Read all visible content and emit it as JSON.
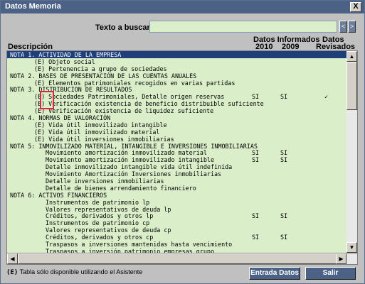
{
  "window": {
    "title": "Datos Memoria",
    "close_label": "X"
  },
  "search": {
    "label": "Texto a buscar",
    "value": "",
    "prev_label": "<",
    "next_label": ">"
  },
  "headers": {
    "description": "Descripción",
    "datos_informados": "Datos Informados",
    "year_2010": "2010",
    "year_2009": "2009",
    "datos": "Datos",
    "revisados": "Revisados"
  },
  "rows": [
    {
      "text": "NOTA 1. ACTIVIDAD DE LA EMPRESA",
      "indent": 0,
      "selected": true
    },
    {
      "text": "(E) Objeto social",
      "indent": 1
    },
    {
      "text": "(E) Pertenencia a grupo de sociedades",
      "indent": 1
    },
    {
      "text": "NOTA 2. BASES DE PRESENTACIÓN DE LAS CUENTAS ANUALES",
      "indent": 0
    },
    {
      "text": "(E) Elementos patrimoniales recogidos en varias partidas",
      "indent": 1
    },
    {
      "text": "NOTA 3. DISTRIBUCION DE RESULTADOS",
      "indent": 0
    },
    {
      "text": "(E) Sociedades Patrimoniales, Detalle origen reservas",
      "indent": 1,
      "c1": "SI",
      "c2": "SI",
      "c3": "✓"
    },
    {
      "text": "(E) Verificación existencia de beneficio distribuible suficiente",
      "indent": 1
    },
    {
      "text": "(E) Verificación existencia de liquidez suficiente",
      "indent": 1
    },
    {
      "text": "NOTA 4. NORMAS DE VALORACIÓN",
      "indent": 0
    },
    {
      "text": "(E) Vida útil inmovilizado intangible",
      "indent": 1
    },
    {
      "text": "(E) Vida útil inmovilizado material",
      "indent": 1
    },
    {
      "text": "(E) Vida útil inversiones inmobiliarias",
      "indent": 1
    },
    {
      "text": "NOTA 5: INMOVILIZADO MATERIAL, INTANGIBLE E INVERSIONES INMOBILIARIAS",
      "indent": 0
    },
    {
      "text": "Movimiento amortización inmovilizado material",
      "indent": 2,
      "c1": "SI",
      "c2": "SI"
    },
    {
      "text": "Movimiento amortización inmovilizado intangible",
      "indent": 2,
      "c1": "SI",
      "c2": "SI"
    },
    {
      "text": "Detalle inmovilizado intangible vida útil indefinida",
      "indent": 2
    },
    {
      "text": "Movimiento Amortización Inversiones inmobiliarias",
      "indent": 2
    },
    {
      "text": "Detalle inversiones inmobiliarias",
      "indent": 2
    },
    {
      "text": "Detalle de bienes arrendamiento financiero",
      "indent": 2
    },
    {
      "text": "NOTA 6: ACTIVOS FINANCIEROS",
      "indent": 0
    },
    {
      "text": "Instrumentos de patrimonio lp",
      "indent": 2
    },
    {
      "text": "Valores representativos de deuda lp",
      "indent": 2
    },
    {
      "text": "Créditos, derivados y otros lp",
      "indent": 2,
      "c1": "SI",
      "c2": "SI"
    },
    {
      "text": "Instrumentos de patrimonio cp",
      "indent": 2
    },
    {
      "text": "Valores representativos de deuda cp",
      "indent": 2
    },
    {
      "text": "Créditos, derivados y otros cp",
      "indent": 2,
      "c1": "SI",
      "c2": "SI"
    },
    {
      "text": "Traspasos a inversiones mantenidas hasta vencimiento",
      "indent": 2
    },
    {
      "text": "Traspasos a inversión patrimonio empresas grupo",
      "indent": 2
    }
  ],
  "footnote": {
    "marker": "(E)",
    "text": "Tabla sólo disponible utilizando el Asistente"
  },
  "buttons": {
    "entrada": "Entrada Datos",
    "salir": "Salir"
  },
  "colors": {
    "selected_row": "#1f3f7a",
    "list_bg": "#d9eec9",
    "highlight_box": "#e0263d",
    "button_bg": "#4b6286"
  }
}
